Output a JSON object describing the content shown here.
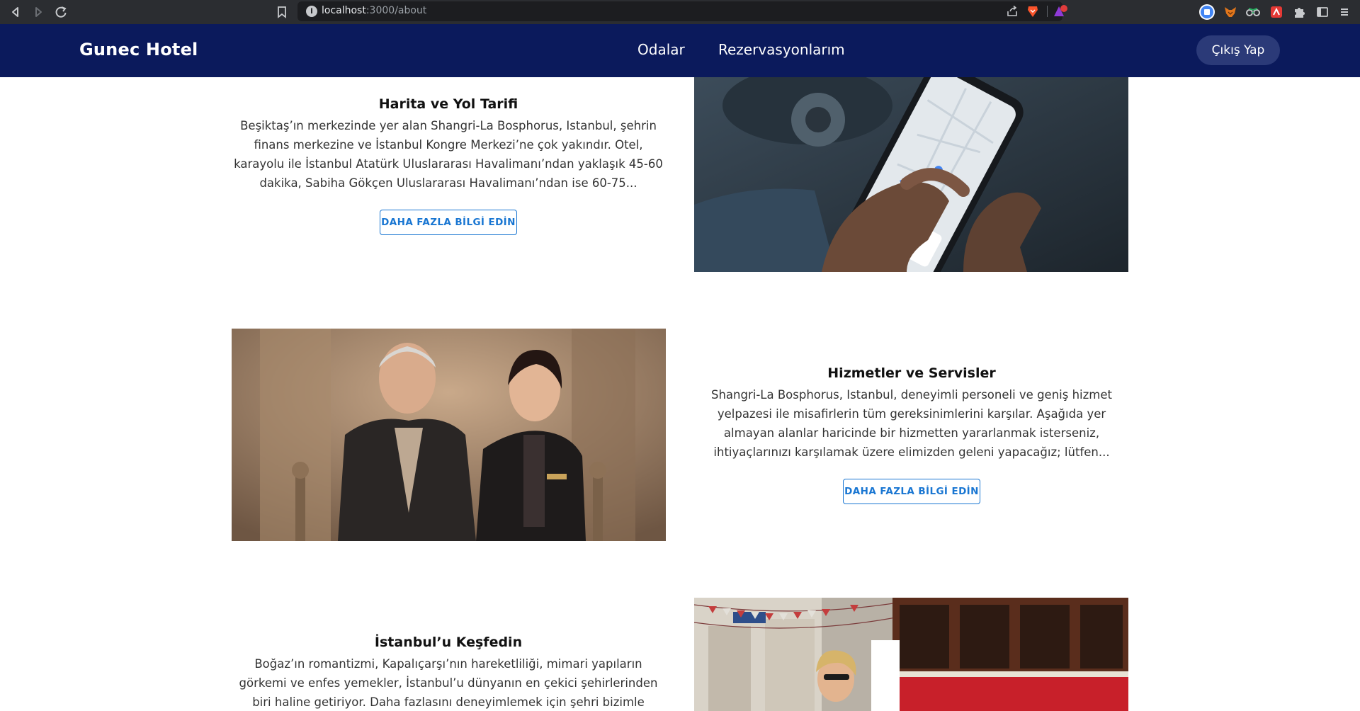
{
  "browser": {
    "url_host": "localhost",
    "url_path": ":3000/about"
  },
  "header": {
    "logo": "Gunec Hotel",
    "nav": [
      {
        "label": "Odalar"
      },
      {
        "label": "Rezervasyonlarım"
      }
    ],
    "logout_label": "Çıkış Yap"
  },
  "sections": [
    {
      "title": "Harita ve Yol Tarifi",
      "text": "Beşiktaş’ın merkezinde yer alan Shangri-La Bosphorus, Istanbul, şehrin finans merkezine ve İstanbul Kongre Merkezi’ne çok yakındır. Otel, karayolu ile İstanbul Atatürk Uluslararası Havalimanı’ndan yaklaşık 45-60 dakika, Sabiha Gökçen Uluslararası Havalimanı’ndan ise 60-75...",
      "button": "DAHA FAZLA BİLGİ EDİN"
    },
    {
      "title": "Hizmetler ve Servisler",
      "text": "Shangri-La Bosphorus, Istanbul, deneyimli personeli ve geniş hizmet yelpazesi ile misafirlerin tüm gereksinimlerini karşılar. Aşağıda yer almayan alanlar haricinde bir hizmetten yararlanmak isterseniz, ihtiyaçlarınızı karşılamak üzere elimizden geleni yapacağız; lütfen...",
      "button": "DAHA FAZLA BİLGİ EDİN"
    },
    {
      "title": "İstanbul’u Keşfedin",
      "text": "Boğaz’ın romantizmi, Kapalıçarşı’nın hareketliliği, mimari yapıların görkemi ve enfes yemekler, İstanbul’u dünyanın en çekici şehirlerinden biri haline getiriyor. Daha fazlasını deneyimlemek için şehri bizimle keşfedin."
    }
  ],
  "colors": {
    "header_bg": "#0b1a5c",
    "logout_bg": "#2b3a78",
    "button_accent": "#1976d2"
  }
}
